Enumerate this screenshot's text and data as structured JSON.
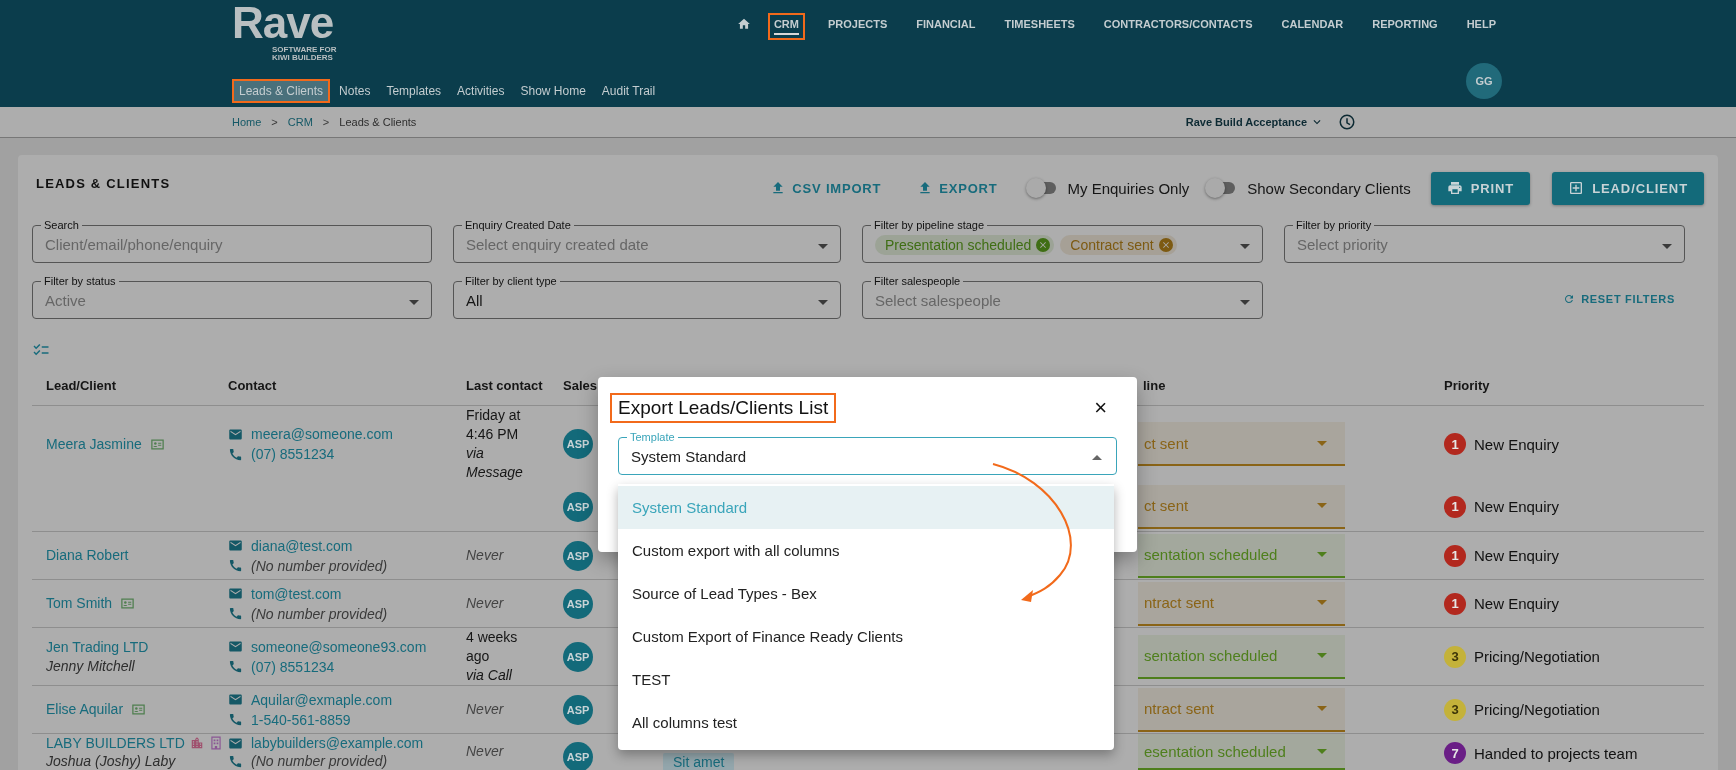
{
  "header": {
    "logo": {
      "name": "Rave",
      "tagline": [
        "SOFTWARE FOR",
        "KIWI BUILDERS"
      ]
    },
    "nav": [
      {
        "label": "CRM",
        "selected": true,
        "annotated": true
      },
      {
        "label": "PROJECTS",
        "selected": false,
        "annotated": false
      },
      {
        "label": "FINANCIAL",
        "selected": false,
        "annotated": false
      },
      {
        "label": "TIMESHEETS",
        "selected": false,
        "annotated": false
      },
      {
        "label": "CONTRACTORS/CONTACTS",
        "selected": false,
        "annotated": false
      },
      {
        "label": "CALENDAR",
        "selected": false,
        "annotated": false
      },
      {
        "label": "REPORTING",
        "selected": false,
        "annotated": false
      },
      {
        "label": "HELP",
        "selected": false,
        "annotated": false
      }
    ],
    "tabs": [
      {
        "label": "Leads & Clients",
        "selected": true,
        "annotated": true
      },
      {
        "label": "Notes",
        "selected": false,
        "annotated": false
      },
      {
        "label": "Templates",
        "selected": false,
        "annotated": false
      },
      {
        "label": "Activities",
        "selected": false,
        "annotated": false
      },
      {
        "label": "Show Home",
        "selected": false,
        "annotated": false
      },
      {
        "label": "Audit Trail",
        "selected": false,
        "annotated": false
      }
    ],
    "avatar": "GG"
  },
  "breadcrumb": {
    "trail": [
      {
        "kind": "link",
        "text": "Home"
      },
      {
        "kind": "separator",
        "text": ">"
      },
      {
        "kind": "link",
        "text": "CRM"
      },
      {
        "kind": "separator",
        "text": ">"
      },
      {
        "kind": "current",
        "text": "Leads & Clients"
      }
    ],
    "company": "Rave Build Acceptance"
  },
  "card": {
    "title": "LEADS & CLIENTS",
    "actions": [
      {
        "kind": "link",
        "label": "CSV IMPORT"
      },
      {
        "kind": "link",
        "label": "EXPORT"
      },
      {
        "kind": "toggle",
        "label": "My Enquiries Only",
        "on": false
      },
      {
        "kind": "toggle",
        "label": "Show Secondary Clients",
        "on": false
      },
      {
        "kind": "button",
        "label": "PRINT"
      },
      {
        "kind": "button",
        "label": "LEAD/CLIENT"
      }
    ],
    "filters": [
      {
        "kind": "text",
        "label": "Search",
        "placeholder": "Client/email/phone/enquiry"
      },
      {
        "kind": "select",
        "label": "Enquiry Created Date",
        "placeholder": "Select enquiry created date"
      },
      {
        "kind": "chips",
        "label": "Filter by pipeline stage",
        "chips": [
          {
            "text": "Presentation scheduled",
            "color": "#3f6e14"
          },
          {
            "text": "Contract sent",
            "color": "#7d5a12"
          }
        ]
      },
      {
        "kind": "select",
        "label": "Filter by priority",
        "placeholder": "Select priority"
      },
      {
        "kind": "select",
        "label": "Filter by status",
        "placeholder": "Active"
      },
      {
        "kind": "select",
        "label": "Filter by client type",
        "value": "All"
      },
      {
        "kind": "select",
        "label": "Filter salespeople",
        "placeholder": "Select salespeople"
      }
    ],
    "reset": "RESET FILTERS"
  },
  "table": {
    "columns": [
      "Lead/Client",
      "Contact",
      "Last contact",
      "Sales",
      "line",
      "Priority"
    ],
    "rows": [
      {
        "kind": "client",
        "lead": {
          "name": "Meera Jasmine",
          "kind": "person"
        },
        "email": "meera@someone.com",
        "phone": {
          "text": "(07) 8551234",
          "provided": true
        },
        "last_contact": {
          "when": "Friday at 4:46 PM",
          "via": "via Message",
          "recorded": true
        },
        "sales": "ASP",
        "pipeline": {
          "text": "ct sent",
          "color": "#8a6417"
        },
        "priority": {
          "number": "1",
          "label": "New Enquiry",
          "color": "#b2281e"
        }
      },
      {
        "kind": "secondary",
        "sales": "ASP",
        "pipeline": {
          "text": "ct sent",
          "color": "#8a6417"
        },
        "priority": {
          "number": "1",
          "label": "New Enquiry",
          "color": "#b2281e"
        }
      },
      {
        "kind": "client",
        "lead": {
          "name": "Diana Robert",
          "kind": "none"
        },
        "email": "diana@test.com",
        "phone": {
          "text": "(No number provided)",
          "provided": false
        },
        "last_contact": {
          "when": "Never",
          "recorded": false
        },
        "sales": "ASP",
        "pipeline": {
          "text": "sentation scheduled",
          "color": "#4e7f1c"
        },
        "priority": {
          "number": "1",
          "label": "New Enquiry",
          "color": "#b2281e"
        }
      },
      {
        "kind": "client",
        "lead": {
          "name": "Tom Smith",
          "kind": "person"
        },
        "email": "tom@test.com",
        "phone": {
          "text": "(No number provided)",
          "provided": false
        },
        "last_contact": {
          "when": "Never",
          "recorded": false
        },
        "sales": "ASP",
        "pipeline": {
          "text": "ntract sent",
          "color": "#8a6417"
        },
        "priority": {
          "number": "1",
          "label": "New Enquiry",
          "color": "#b2281e"
        }
      },
      {
        "kind": "client",
        "lead": {
          "name": "Jen Trading LTD",
          "contact": "Jenny Mitchell",
          "kind": "none"
        },
        "email": "someone@someone93.com",
        "phone": {
          "text": "(07) 8551234",
          "provided": true
        },
        "last_contact": {
          "when": "4 weeks ago",
          "via": "via Call",
          "recorded": true
        },
        "sales": "ASP",
        "pipeline": {
          "text": "sentation scheduled",
          "color": "#4e7f1c"
        },
        "priority": {
          "number": "3",
          "label": "Pricing/Negotiation",
          "color": "#c4b23a"
        }
      },
      {
        "kind": "client",
        "lead": {
          "name": "Elise Aquilar",
          "kind": "person"
        },
        "email": "Aquilar@exmaple.com",
        "phone": {
          "text": "1-540-561-8859",
          "provided": true
        },
        "last_contact": {
          "when": "Never",
          "recorded": false
        },
        "sales": "ASP",
        "pipeline": {
          "text": "ntract sent",
          "color": "#8a6417"
        },
        "priority": {
          "number": "3",
          "label": "Pricing/Negotiation",
          "color": "#c4b23a"
        }
      },
      {
        "kind": "client",
        "lead": {
          "name": "LABY BUILDERS LTD",
          "contact": "Joshua (Joshy) Laby",
          "kind": "company"
        },
        "email": "labybuilders@example.com",
        "phone": {
          "text": "(No number provided)",
          "provided": false
        },
        "last_contact": {
          "when": "Never",
          "recorded": false
        },
        "sales": "ASP",
        "tag": "Sit amet",
        "pipeline": {
          "text": "esentation scheduled",
          "color": "#4e7f1c"
        },
        "priority": {
          "number": "7",
          "label": "Handed to projects team",
          "color": "#6a1e86"
        }
      }
    ]
  },
  "modal": {
    "title": "Export Leads/Clients List",
    "annotated": true,
    "close": "×",
    "field": {
      "label": "Template",
      "value": "System Standard",
      "expanded": true
    },
    "options": [
      {
        "label": "System Standard",
        "selected": true
      },
      {
        "label": "Custom export with all columns",
        "selected": false
      },
      {
        "label": "Source of Lead Types - Bex",
        "selected": false
      },
      {
        "label": "Custom Export of Finance Ready Clients",
        "selected": false
      },
      {
        "label": "TEST",
        "selected": false
      },
      {
        "label": "All columns test",
        "selected": false
      }
    ]
  }
}
